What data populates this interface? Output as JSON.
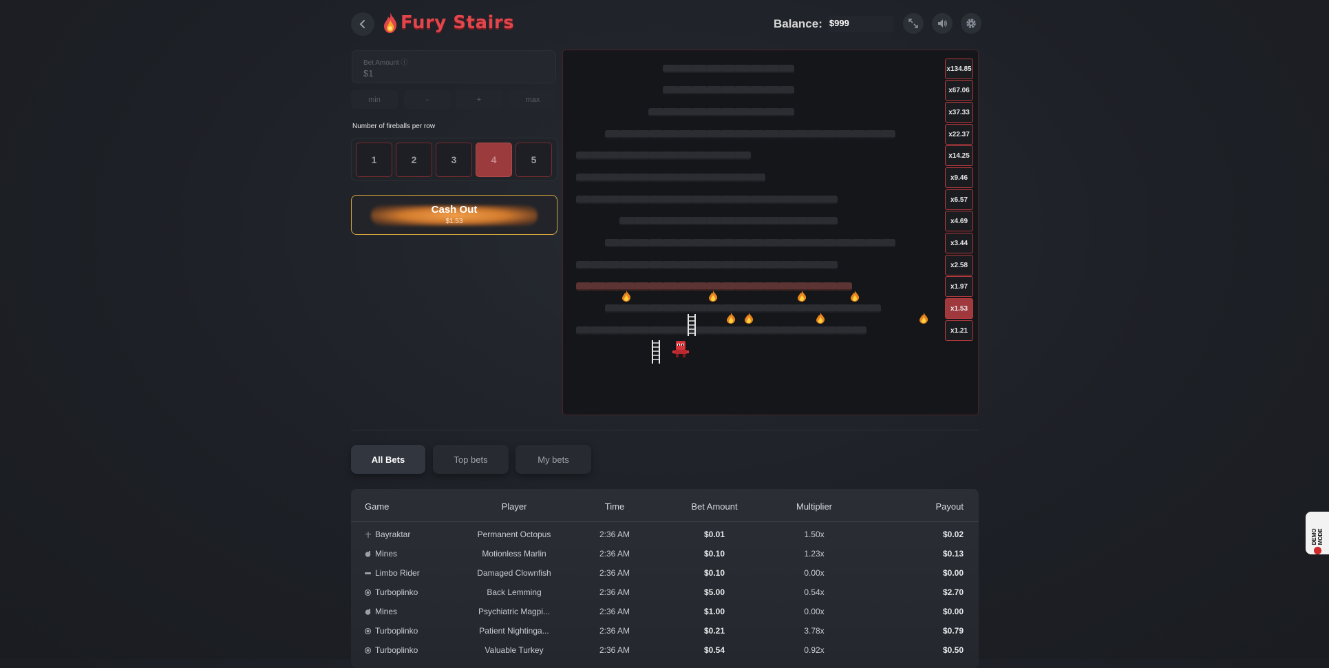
{
  "header": {
    "title": "Fury Stairs",
    "balance_label": "Balance:",
    "balance_value": "$999",
    "icons": [
      "back-arrow-icon",
      "fireball-logo-icon",
      "fullscreen-icon",
      "volume-icon",
      "settings-gear-icon"
    ]
  },
  "bet": {
    "label": "Bet Amount ⓘ",
    "value": "$1",
    "min": "min",
    "minus": "-",
    "plus": "+",
    "max": "max"
  },
  "fireballs": {
    "label": "Number of fireballs per row",
    "options": [
      "1",
      "2",
      "3",
      "4",
      "5"
    ],
    "selected": "4"
  },
  "cashout": {
    "label": "Cash Out",
    "amount": "$1.53"
  },
  "board": {
    "multipliers": [
      "x134.85",
      "x67.06",
      "x37.33",
      "x22.37",
      "x14.25",
      "x9.46",
      "x6.57",
      "x4.69",
      "x3.44",
      "x2.58",
      "x1.97",
      "x1.53",
      "x1.21"
    ],
    "current_multiplier": "x1.53",
    "colors": {
      "accent": "#e0464b",
      "active": "#a0393d",
      "cashout_border": "#d7a73c"
    }
  },
  "tabs": [
    "All Bets",
    "Top bets",
    "My bets"
  ],
  "active_tab": "All Bets",
  "table": {
    "headers": [
      "Game",
      "Player",
      "Time",
      "Bet Amount",
      "Multiplier",
      "Payout"
    ],
    "rows": [
      [
        "Bayraktar",
        "Permanent Octopus",
        "2:36 AM",
        "$0.01",
        "1.50x",
        "$0.02"
      ],
      [
        "Mines",
        "Motionless Marlin",
        "2:36 AM",
        "$0.10",
        "1.23x",
        "$0.13"
      ],
      [
        "Limbo Rider",
        "Damaged Clownfish",
        "2:36 AM",
        "$0.10",
        "0.00x",
        "$0.00"
      ],
      [
        "Turboplinko",
        "Back Lemming",
        "2:36 AM",
        "$5.00",
        "0.54x",
        "$2.70"
      ],
      [
        "Mines",
        "Psychiatric Magpi...",
        "2:36 AM",
        "$1.00",
        "0.00x",
        "$0.00"
      ],
      [
        "Turboplinko",
        "Patient Nightinga...",
        "2:36 AM",
        "$0.21",
        "3.78x",
        "$0.79"
      ],
      [
        "Turboplinko",
        "Valuable Turkey",
        "2:36 AM",
        "$0.54",
        "0.92x",
        "$0.50"
      ]
    ]
  },
  "demo_mode": "DEMO MODE"
}
